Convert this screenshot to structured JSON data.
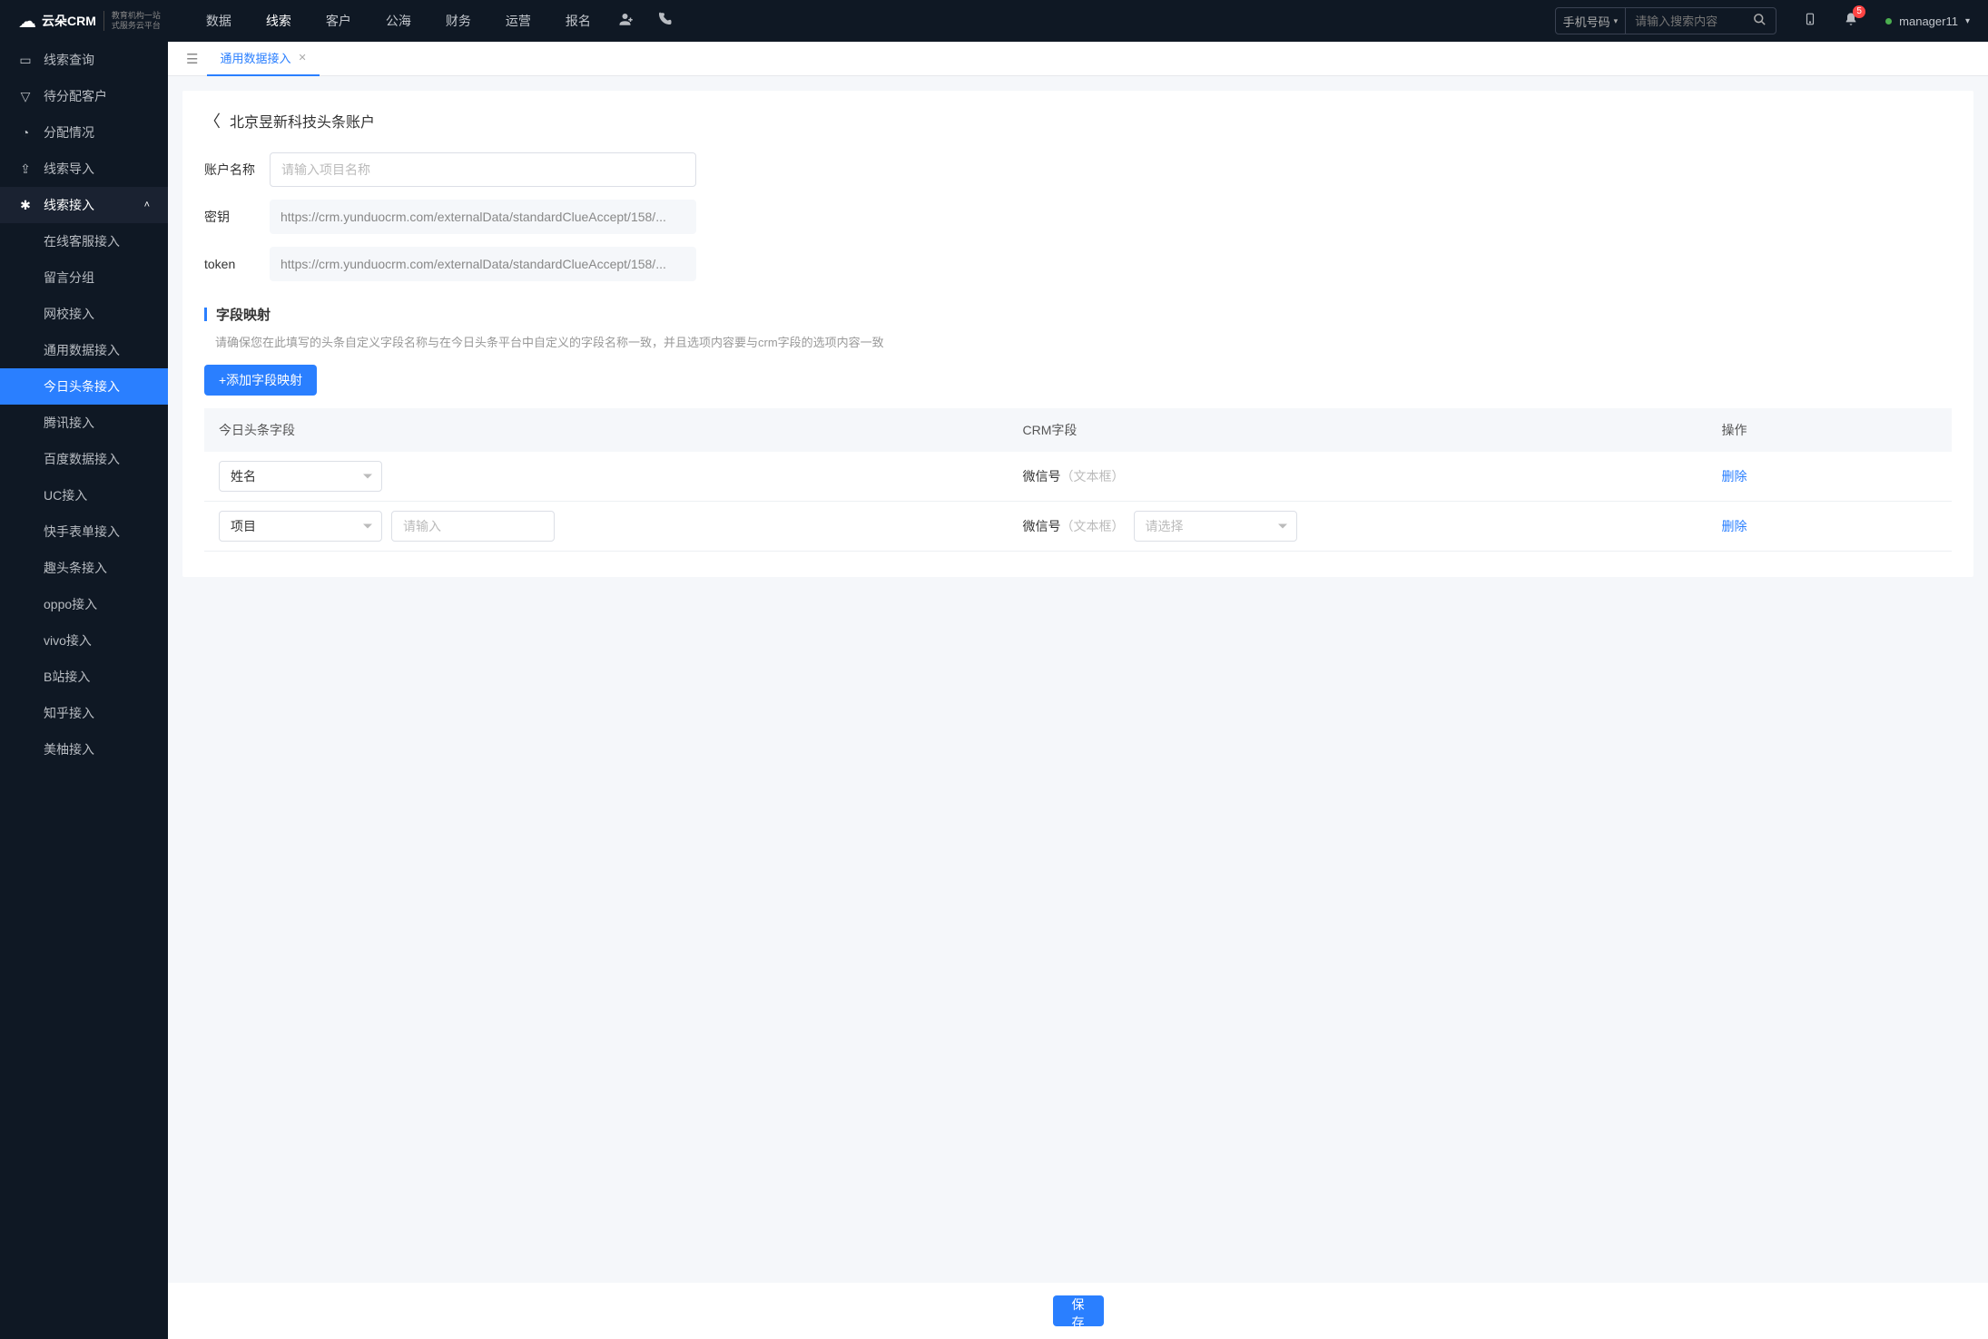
{
  "header": {
    "logo": "云朵CRM",
    "logo_sub1": "教育机构一站",
    "logo_sub2": "式服务云平台",
    "nav": [
      "数据",
      "线索",
      "客户",
      "公海",
      "财务",
      "运营",
      "报名"
    ],
    "nav_active": 1,
    "search_type": "手机号码",
    "search_placeholder": "请输入搜索内容",
    "badge": "5",
    "user": "manager11"
  },
  "sidebar": {
    "items": [
      {
        "icon": "▭",
        "label": "线索查询"
      },
      {
        "icon": "▽",
        "label": "待分配客户"
      },
      {
        "icon": "◔",
        "label": "分配情况"
      },
      {
        "icon": "⇪",
        "label": "线索导入"
      },
      {
        "icon": "✱",
        "label": "线索接入",
        "open": true,
        "children": [
          "在线客服接入",
          "留言分组",
          "网校接入",
          "通用数据接入",
          "今日头条接入",
          "腾讯接入",
          "百度数据接入",
          "UC接入",
          "快手表单接入",
          "趣头条接入",
          "oppo接入",
          "vivo接入",
          "B站接入",
          "知乎接入",
          "美柚接入"
        ],
        "active_child": 4
      }
    ]
  },
  "tab": {
    "label": "通用数据接入"
  },
  "page": {
    "title": "北京昱新科技头条账户",
    "form": {
      "name_label": "账户名称",
      "name_placeholder": "请输入项目名称",
      "secret_label": "密钥",
      "secret_value": "https://crm.yunduocrm.com/externalData/standardClueAccept/158/...",
      "token_label": "token",
      "token_value": "https://crm.yunduocrm.com/externalData/standardClueAccept/158/..."
    },
    "section_title": "字段映射",
    "section_desc": "请确保您在此填写的头条自定义字段名称与在今日头条平台中自定义的字段名称一致，并且选项内容要与crm字段的选项内容一致",
    "add_button": "+添加字段映射",
    "table": {
      "headers": [
        "今日头条字段",
        "CRM字段",
        "操作"
      ],
      "rows": [
        {
          "field": "姓名",
          "crm_label": "微信号",
          "crm_hint": "（文本框）",
          "extra": false
        },
        {
          "field": "项目",
          "crm_label": "微信号",
          "crm_hint": "（文本框）",
          "extra": true,
          "input_placeholder": "请输入",
          "select_placeholder": "请选择"
        }
      ],
      "delete": "删除"
    },
    "save": "保存"
  }
}
